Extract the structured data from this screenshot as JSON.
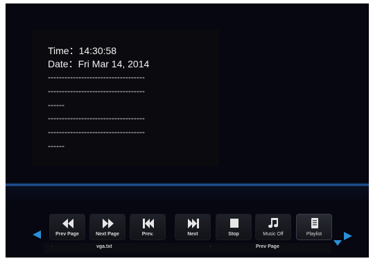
{
  "info": {
    "time_label": "Time",
    "time_value": "14:30:58",
    "date_label": "Date",
    "date_value": "Fri Mar 14, 2014",
    "dash_lines": [
      "-----------------------------------",
      "-----------------------------------",
      "------",
      "-----------------------------------",
      "-----------------------------------",
      "------"
    ]
  },
  "toolbar": {
    "buttons": [
      {
        "label": "Prev Page",
        "icon": "rewind-icon"
      },
      {
        "label": "Next Page",
        "icon": "fast-forward-icon"
      },
      {
        "label": "Prev.",
        "icon": "skip-previous-icon"
      },
      {
        "label": "Next",
        "icon": "skip-next-icon"
      },
      {
        "label": "Stop",
        "icon": "stop-icon"
      },
      {
        "label": "Music Off",
        "icon": "music-note-icon"
      },
      {
        "label": "Playlist",
        "icon": "playlist-icon"
      }
    ]
  },
  "status": {
    "filename": "vga.txt",
    "action": "Prev Page"
  },
  "colors": {
    "background": "#060710",
    "accent": "#2b8fd9",
    "text": "#f2f2f2"
  }
}
